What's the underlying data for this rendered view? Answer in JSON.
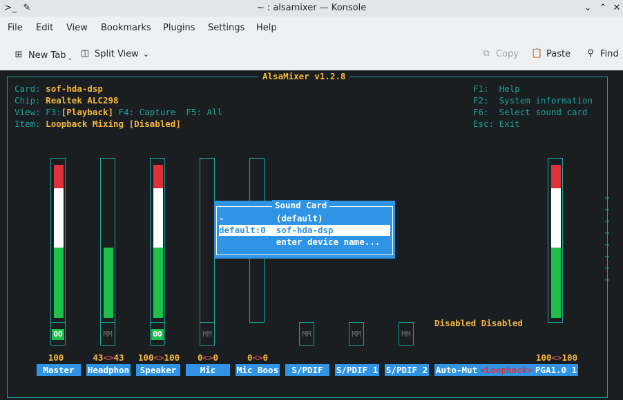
{
  "window": {
    "title": "~ : alsamixer — Konsole",
    "left_icon": "terminal-icon",
    "pin_icon": "pin-icon"
  },
  "menubar": {
    "items": [
      "File",
      "Edit",
      "View",
      "Bookmarks",
      "Plugins",
      "Settings",
      "Help"
    ]
  },
  "toolbar": {
    "new_tab": "New Tab",
    "split_view": "Split View",
    "copy": "Copy",
    "paste": "Paste",
    "find": "Find"
  },
  "alsamixer": {
    "frame_title": "AlsaMixer v1.2.8",
    "card_label": "Card:",
    "card_value": "sof-hda-dsp",
    "chip_label": "Chip:",
    "chip_value": "Realtek ALC298",
    "view_label": "View:",
    "view_f3": "F3:",
    "view_playback": "[Playback]",
    "view_f4": "F4: Capture",
    "view_f5": "F5: All",
    "item_label": "Item:",
    "item_value": "Loopback Mixing [Disabled]",
    "help_keys": [
      {
        "key": "F1:",
        "desc": "Help"
      },
      {
        "key": "F2:",
        "desc": "System information"
      },
      {
        "key": "F6:",
        "desc": "Select sound card"
      },
      {
        "key": "Esc:",
        "desc": "Exit"
      }
    ],
    "disabled_text": "Disabled Disabled",
    "controls": [
      {
        "name": "Master",
        "value": "100",
        "meter": true,
        "level": 100,
        "mute": "OO",
        "mute_on": true
      },
      {
        "name": "Headphon",
        "value_left": "43",
        "value_right": "43",
        "sep": "<>",
        "meter": true,
        "level": 43,
        "mute": "MM",
        "mute_on": false
      },
      {
        "name": "Speaker",
        "value_left": "100",
        "value_right": "100",
        "sep": "<>",
        "meter": true,
        "level": 100,
        "mute": "OO",
        "mute_on": true
      },
      {
        "name": "Mic",
        "value_left": "0",
        "value_right": "0",
        "sep": "<>",
        "meter": true,
        "level": 0,
        "mute": "MM",
        "mute_on": false
      },
      {
        "name": "Mic Boos",
        "value_left": "0",
        "value_right": "0",
        "sep": "<>",
        "meter": true,
        "level": 0
      },
      {
        "name": "S/PDIF",
        "mute": "MM"
      },
      {
        "name": "S/PDIF 1",
        "mute": "MM"
      },
      {
        "name": "S/PDIF 2",
        "mute": "MM"
      },
      {
        "name": "Auto-Mut"
      },
      {
        "name": "Loopback"
      },
      {
        "name": "PGA1.0 1",
        "value_left": "100",
        "value_right": "100",
        "sep": "<>",
        "meter": true,
        "level": 100
      }
    ],
    "sound_card_dialog": {
      "title": "Sound Card",
      "rows": [
        {
          "id": "-",
          "name": "(default)"
        },
        {
          "id": "default:0",
          "name": "sof-hda-dsp"
        },
        {
          "id": "",
          "name": "enter device name..."
        }
      ],
      "selected_index": 1
    }
  }
}
